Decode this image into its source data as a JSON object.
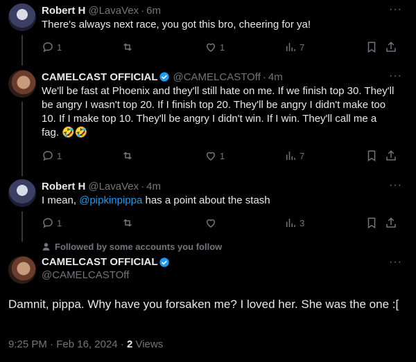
{
  "replies": [
    {
      "name": "Robert H",
      "handle": "@LavaVex",
      "time": "6m",
      "text": "There's always next race, you got this bro, cheering for ya!",
      "replies_count": "1",
      "retweets_count": "",
      "likes_count": "1",
      "views_count": "7"
    },
    {
      "name": "CAMELCAST OFFICIAL",
      "handle": "@CAMELCASTOff",
      "time": "4m",
      "text": "We'll be fast at Phoenix and they'll still hate on me. If we finish top 30. They'll be angry I wasn't top 20. If I finish top 20. They'll be angry I didn't make too 10. If I make top 10. They'll be angry I didn't win. If I win. They'll call me a fag. 🤣🤣",
      "replies_count": "1",
      "retweets_count": "",
      "likes_count": "1",
      "views_count": "7"
    },
    {
      "name": "Robert H",
      "handle": "@LavaVex",
      "time": "4m",
      "text_before": "I mean, ",
      "mention": "@pipkinpippa",
      "text_after": " has a point about the stash",
      "replies_count": "1",
      "retweets_count": "",
      "likes_count": "",
      "views_count": "3"
    }
  ],
  "followed_note": "Followed by some accounts you follow",
  "main": {
    "name": "CAMELCAST OFFICIAL",
    "handle": "@CAMELCASTOff",
    "text": "Damnit, pippa. Why have you forsaken me? I loved her. She was the one :[",
    "time": "9:25 PM",
    "date": "Feb 16, 2024",
    "views": "2",
    "views_label": "Views"
  },
  "colors": {
    "accent": "#1d9bf0",
    "muted": "#71767b",
    "background": "#000000"
  }
}
